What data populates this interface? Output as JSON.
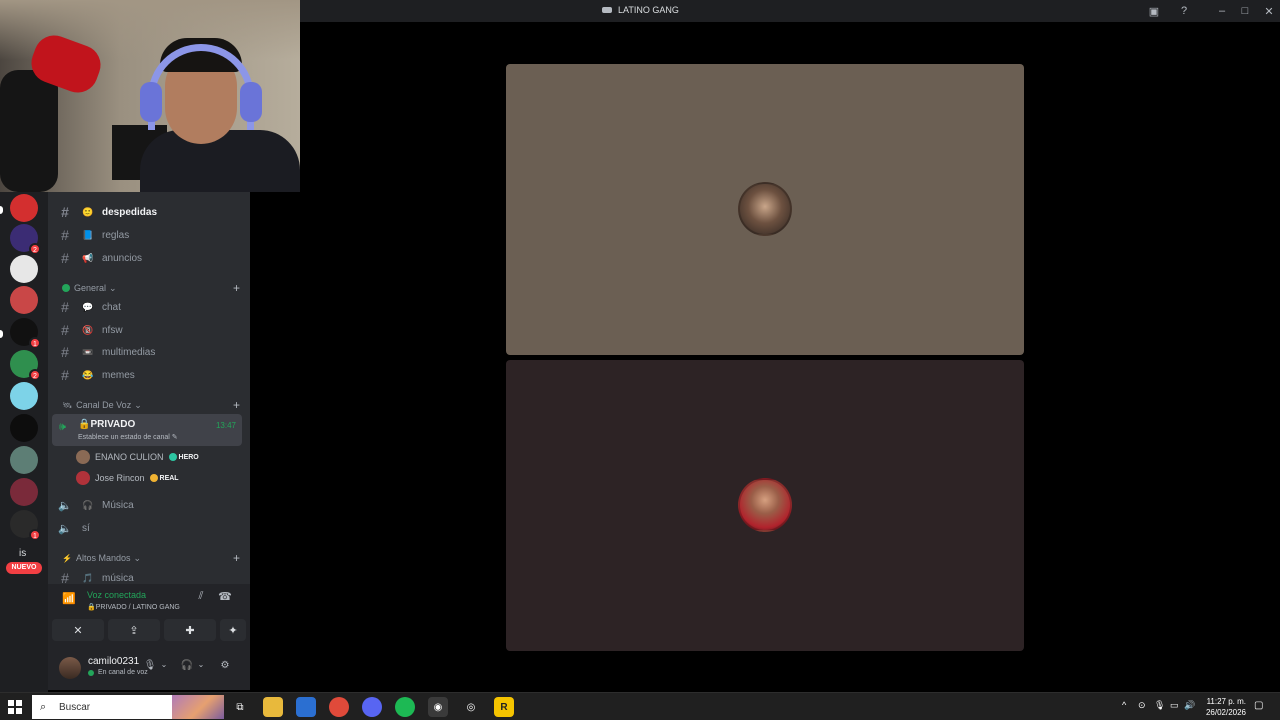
{
  "window": {
    "title": "LATINO GANG",
    "controls": {
      "inbox_icon": "inbox-icon",
      "help_icon": "help-icon",
      "minimize": "–",
      "maximize": "□",
      "close": "✕"
    }
  },
  "server_rail": {
    "badges": [
      "2",
      "1",
      "2",
      "1"
    ],
    "partial_text": "is",
    "new_label": "NUEVO"
  },
  "channels": {
    "text": [
      {
        "emoji": "🙂",
        "name": "despedidas",
        "unread": true
      },
      {
        "emoji": "📘",
        "name": "reglas",
        "unread": false
      },
      {
        "emoji": "📢",
        "name": "anuncios",
        "unread": false
      }
    ],
    "category_general": "General",
    "general": [
      {
        "emoji": "💬",
        "name": "chat"
      },
      {
        "emoji": "🔞",
        "name": "nfsw"
      },
      {
        "emoji": "📼",
        "name": "multimedias"
      },
      {
        "emoji": "😂",
        "name": "memes"
      }
    ],
    "category_voice": "Canal De Voz",
    "active_voice": {
      "name": "🔒PRIVADO",
      "status": "Establece un estado de canal ✎",
      "time": "13:47"
    },
    "members": [
      {
        "name": "ENANO CULION",
        "tag": "HERO",
        "tag_color": "#2dc5a2"
      },
      {
        "name": "Jose Rincon",
        "tag": "REAL",
        "tag_color": "#f0b232"
      }
    ],
    "voice_channels": [
      {
        "emoji": "🎧",
        "name": "Música"
      },
      {
        "emoji": "",
        "name": "sí"
      }
    ],
    "category_altos": "Altos Mandos",
    "altos": [
      {
        "emoji": "🎵",
        "name": "música"
      }
    ]
  },
  "voice_panel": {
    "connected": "Voz conectada",
    "location": "🔒PRIVADO / LATINO GANG",
    "buttons": [
      "camera-off-icon",
      "screen-share-icon",
      "activities-icon",
      "soundboard-icon"
    ]
  },
  "user": {
    "name": "camilo0231",
    "status": "En canal de voz"
  },
  "stage": {
    "tiles": [
      {
        "color": "#6b5f53"
      },
      {
        "color": "#2d2325"
      }
    ]
  },
  "taskbar": {
    "search_placeholder": "Buscar",
    "time": "11:27 p. m.",
    "date": "26/02/2026",
    "tray_arrow": "^"
  },
  "colors": {
    "accent_green": "#23a55a",
    "danger_red": "#f23f43",
    "sidebar_bg": "#2b2d31",
    "rail_bg": "#1e1f22"
  }
}
